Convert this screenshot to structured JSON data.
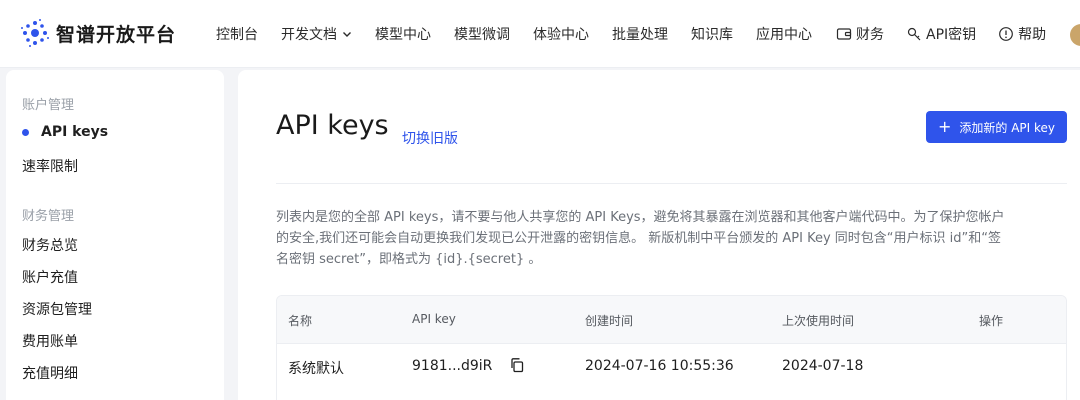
{
  "brand": {
    "name": "智谱开放平台",
    "accent": "#2f54eb"
  },
  "nav": {
    "items": [
      {
        "label": "控制台"
      },
      {
        "label": "开发文档",
        "dropdown": true
      },
      {
        "label": "模型中心"
      },
      {
        "label": "模型微调"
      },
      {
        "label": "体验中心"
      },
      {
        "label": "批量处理"
      },
      {
        "label": "知识库"
      },
      {
        "label": "应用中心"
      }
    ],
    "utils": [
      {
        "label": "财务",
        "icon": "wallet-icon"
      },
      {
        "label": "API密钥",
        "icon": "key-icon"
      },
      {
        "label": "帮助",
        "icon": "help-icon"
      }
    ]
  },
  "sidebar": {
    "group1": "账户管理",
    "items1": [
      {
        "label": "API keys",
        "active": true
      },
      {
        "label": "速率限制"
      }
    ],
    "group2": "财务管理",
    "items2": [
      {
        "label": "财务总览"
      },
      {
        "label": "账户充值"
      },
      {
        "label": "资源包管理"
      },
      {
        "label": "费用账单"
      },
      {
        "label": "充值明细"
      }
    ]
  },
  "main": {
    "title": "API keys",
    "switch_link": "切换旧版",
    "add_button": "添加新的 API key",
    "description": "列表内是您的全部 API keys，请不要与他人共享您的 API Keys，避免将其暴露在浏览器和其他客户端代码中。为了保护您帐户的安全,我们还可能会自动更换我们发现已公开泄露的密钥信息。 新版机制中平台颁发的 API Key 同时包含“用户标识 id”和“签名密钥 secret”，即格式为 {id}.{secret} 。"
  },
  "table": {
    "headers": [
      "名称",
      "API key",
      "创建时间",
      "上次使用时间",
      "操作"
    ],
    "rows": [
      {
        "name": "系统默认",
        "key": "9181...d9iR",
        "created": "2024-07-16 10:55:36",
        "last_used": "2024-07-18"
      }
    ]
  }
}
